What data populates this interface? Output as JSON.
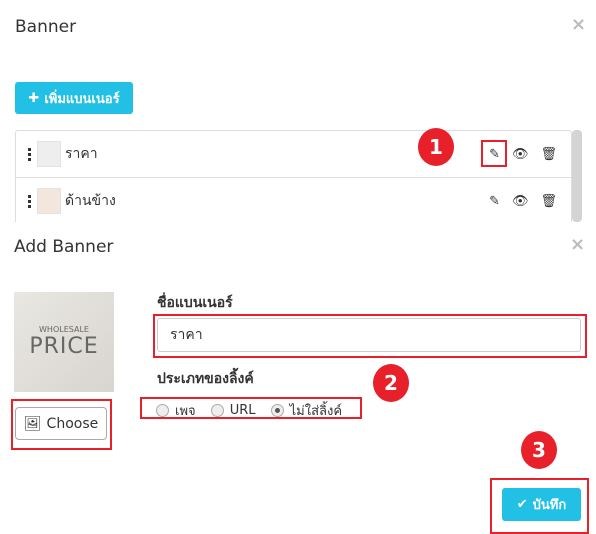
{
  "banner_modal": {
    "title": "Banner",
    "close": "×",
    "add_button": "เพิ่มแบนเนอร์",
    "items": [
      {
        "label": "ราคา"
      },
      {
        "label": "ด้านข้าง"
      }
    ]
  },
  "add_modal": {
    "title": "Add Banner",
    "close": "×",
    "image_text": {
      "line1": "WHOLESALE",
      "line2": "PRICE"
    },
    "choose_button": "Choose",
    "name_label": "ชื่อแบนเนอร์",
    "name_value": "ราคา",
    "link_type_label": "ประเภทของลิ้งค์",
    "link_options": [
      {
        "label": "เพจ",
        "checked": false
      },
      {
        "label": "URL",
        "checked": false
      },
      {
        "label": "ไม่ใส่ลิ้งค์",
        "checked": true
      }
    ],
    "save_button": "บันทึก"
  },
  "badges": [
    "1",
    "2",
    "3"
  ],
  "colors": {
    "accent": "#23c0e6",
    "annotation": "#e8202a"
  }
}
